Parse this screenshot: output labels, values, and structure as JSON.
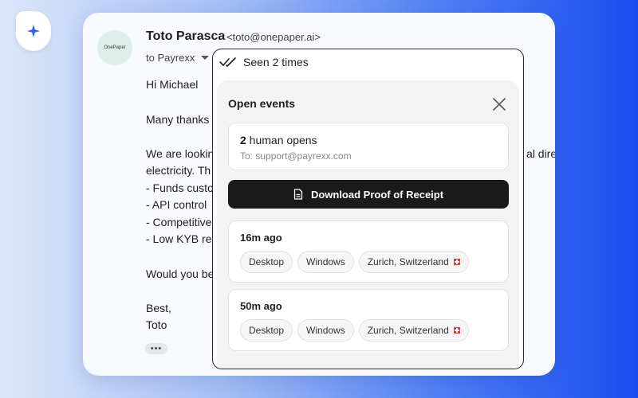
{
  "sender": {
    "name": "Toto Parasca",
    "email": "<toto@onepaper.ai>",
    "avatar_text": "OnePaper",
    "to_line": "to Payrexx"
  },
  "email_body": {
    "greeting": "Hi Michael",
    "line_2": "Many thanks",
    "line_3": "We are lookin",
    "line_3_tail": "al dire",
    "line_4": "electricity. Th",
    "bullet_1": "- Funds custo",
    "bullet_2": "- API control",
    "bullet_3": "- Competitive",
    "bullet_4": "- Low KYB re",
    "question": "Would you be",
    "signoff": "Best,",
    "signature": "Toto",
    "more_label": "•••"
  },
  "popover": {
    "seen_label": "Seen 2 times",
    "title": "Open events",
    "summary": {
      "count": "2",
      "label": " human opens",
      "to_line": "To: support@payrexx.com"
    },
    "download_label": "Download Proof of Receipt",
    "events": [
      {
        "time": "16m ago",
        "device": "Desktop",
        "os": "Windows",
        "location": "Zurich, Switzerland"
      },
      {
        "time": "50m ago",
        "device": "Desktop",
        "os": "Windows",
        "location": "Zurich, Switzerland"
      }
    ]
  },
  "icons": {
    "app_logo": "sparkle-icon",
    "seen": "double-check-icon",
    "close": "close-icon",
    "download": "document-icon",
    "flag": "swiss-flag-icon"
  },
  "colors": {
    "logo_accent": "#2f5ff5",
    "button_dark": "#1a1a1a",
    "flag_red": "#e53935"
  }
}
